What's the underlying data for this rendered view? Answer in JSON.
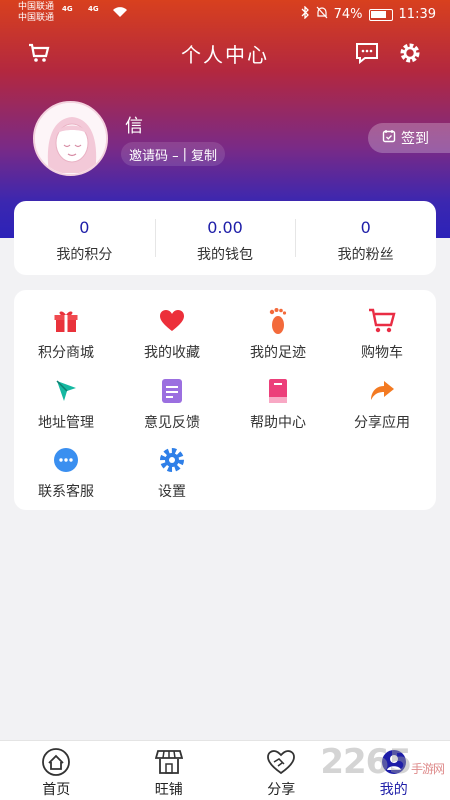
{
  "status": {
    "carrier1": "中国联通",
    "carrier2": "中国联通",
    "net1": "4G",
    "net2": "4G",
    "battery": "74%",
    "time": "11:39"
  },
  "header": {
    "title": "个人中心"
  },
  "profile": {
    "name": "信",
    "invite_label": "邀请码 –",
    "copy_label": "复制",
    "signin_label": "签到"
  },
  "stats": [
    {
      "value": "0",
      "label": "我的积分"
    },
    {
      "value": "0.00",
      "label": "我的钱包"
    },
    {
      "value": "0",
      "label": "我的粉丝"
    }
  ],
  "menu": [
    {
      "label": "积分商城",
      "icon": "gift-icon"
    },
    {
      "label": "我的收藏",
      "icon": "heart-icon"
    },
    {
      "label": "我的足迹",
      "icon": "footprint-icon"
    },
    {
      "label": "购物车",
      "icon": "cart-icon"
    },
    {
      "label": "地址管理",
      "icon": "location-icon"
    },
    {
      "label": "意见反馈",
      "icon": "feedback-icon"
    },
    {
      "label": "帮助中心",
      "icon": "book-icon"
    },
    {
      "label": "分享应用",
      "icon": "share-icon"
    },
    {
      "label": "联系客服",
      "icon": "chat-icon"
    },
    {
      "label": "设置",
      "icon": "gear-icon"
    }
  ],
  "tabs": [
    {
      "label": "首页"
    },
    {
      "label": "旺铺"
    },
    {
      "label": "分享"
    },
    {
      "label": "我的"
    }
  ],
  "watermark": {
    "text": "2265",
    "sub": "手游网"
  },
  "colors": {
    "accent": "#1e1ea8",
    "gradient_top": "#d8401e",
    "gradient_bottom": "#2c22b8"
  }
}
